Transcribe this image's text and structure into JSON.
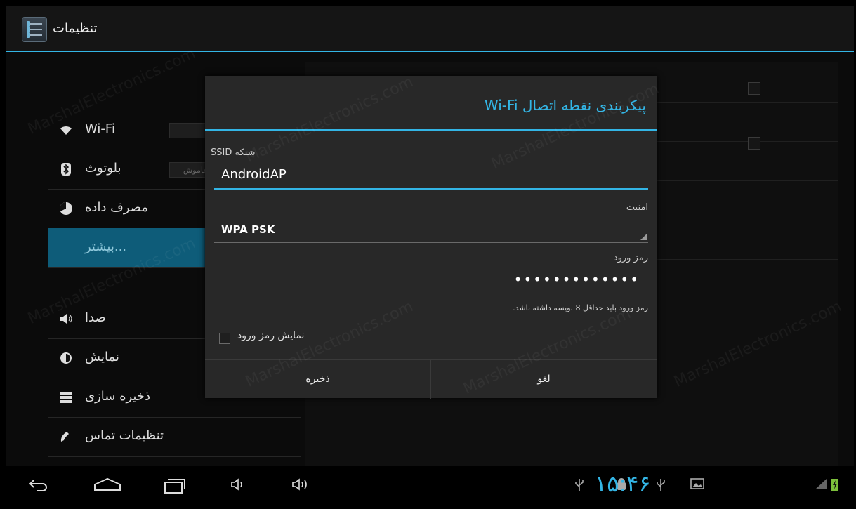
{
  "app": {
    "title": "تنظیمات"
  },
  "sidebar": {
    "items": [
      {
        "label": "Wi-Fi",
        "icon": "wifi-icon",
        "toggle": ""
      },
      {
        "label": "بلوتوث",
        "icon": "bluetooth-icon",
        "toggle": "خاموش"
      },
      {
        "label": "مصرف داده",
        "icon": "data-usage-icon"
      },
      {
        "label": "بیشتر...",
        "selected": true
      },
      {
        "label": "صدا",
        "icon": "volume-icon"
      },
      {
        "label": "نمایش",
        "icon": "brightness-icon"
      },
      {
        "label": "ذخیره سازی",
        "icon": "storage-icon"
      },
      {
        "label": "تنظیمات تماس",
        "icon": "phone-icon"
      }
    ]
  },
  "dialog": {
    "title": "پیکربندی نقطه اتصال Wi-Fi",
    "ssid_label": "شبکه SSID",
    "ssid_value": "AndroidAP",
    "security_label": "امنیت",
    "security_value": "WPA PSK",
    "password_label": "رمز ورود",
    "password_dots": "•••••••••••••",
    "password_hint": "رمز ورود باید حداقل 8 نویسه داشته باشد.",
    "show_password_label": "نمایش رمز ورود",
    "save_label": "ذخیره",
    "cancel_label": "لغو"
  },
  "statusbar": {
    "time": "۱۵:۴۶"
  },
  "colors": {
    "accent": "#33b5e5",
    "selected_bg": "#0e5c79",
    "dialog_bg": "#282828"
  }
}
